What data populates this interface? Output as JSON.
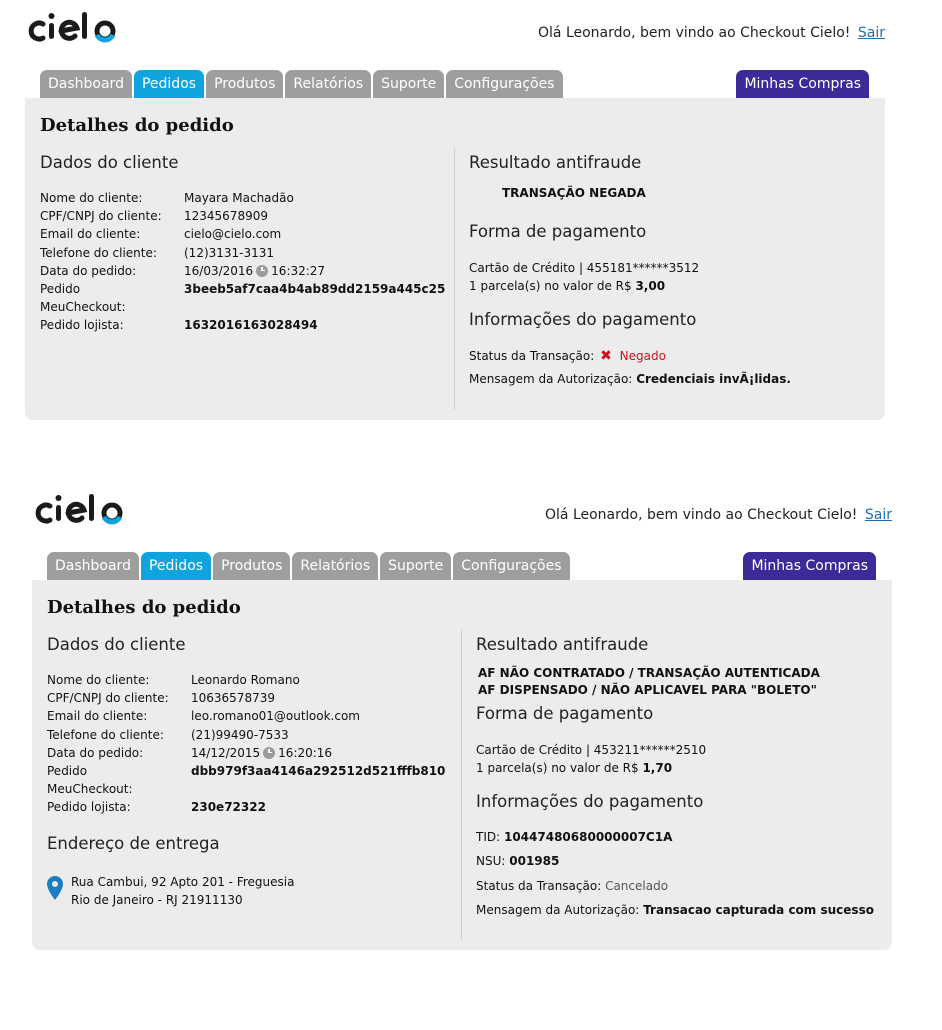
{
  "colors": {
    "active_tab": "#10a4df",
    "tab": "#9e9e9e",
    "minhas_compras": "#3b2a98",
    "panel": "#ececec",
    "negado": "#c9151f",
    "link": "#1a6fb7"
  },
  "icons": {
    "logo": "cielo-logo",
    "clock": "clock-icon",
    "deny": "x-icon",
    "location": "map-pin-icon"
  },
  "screens": [
    {
      "header": {
        "logo_text": "cielo",
        "greeting": "Olá Leonardo, bem vindo ao Checkout Cielo!",
        "logout": "Sair"
      },
      "tabs": [
        "Dashboard",
        "Pedidos",
        "Produtos",
        "Relatórios",
        "Suporte",
        "Configurações"
      ],
      "active_tab": "Pedidos",
      "minhas_compras": "Minhas Compras",
      "title": "Detalhes do pedido",
      "cliente": {
        "heading": "Dados do cliente",
        "nome_label": "Nome do cliente:",
        "nome": "Mayara Machadão",
        "cpf_label": "CPF/CNPJ do cliente:",
        "cpf": "12345678909",
        "email_label": "Email do cliente:",
        "email": "cielo@cielo.com",
        "telefone_label": "Telefone do cliente:",
        "telefone": "(12)3131-3131",
        "data_label": "Data do pedido:",
        "data": "16/03/2016",
        "hora": "16:32:27",
        "pedido_label": "Pedido",
        "pedido_label2": "MeuCheckout:",
        "pedido": "3beeb5af7caa4b4ab89dd2159a445c25",
        "lojista_label": "Pedido lojista:",
        "lojista": "1632016163028494"
      },
      "antifraude": {
        "heading": "Resultado antifraude",
        "line1": "TRANSAÇÃO NEGADA"
      },
      "pagamento": {
        "heading": "Forma de pagamento",
        "cartao": "Cartão de Crédito | 455181******3512",
        "parcela_prefix": "1 parcela(s) no valor de R$",
        "parcela_valor": "3,00"
      },
      "info": {
        "heading": "Informações do pagamento",
        "status_label": "Status da Transação:",
        "status": "Negado",
        "msg_label": "Mensagem da Autorização:",
        "msg": "Credenciais invÃ¡lidas."
      }
    },
    {
      "header": {
        "logo_text": "cielo",
        "greeting": "Olá Leonardo, bem vindo ao Checkout Cielo!",
        "logout": "Sair"
      },
      "tabs": [
        "Dashboard",
        "Pedidos",
        "Produtos",
        "Relatórios",
        "Suporte",
        "Configurações"
      ],
      "active_tab": "Pedidos",
      "minhas_compras": "Minhas Compras",
      "title": "Detalhes do pedido",
      "cliente": {
        "heading": "Dados do cliente",
        "nome_label": "Nome do cliente:",
        "nome": "Leonardo Romano",
        "cpf_label": "CPF/CNPJ do cliente:",
        "cpf": "10636578739",
        "email_label": "Email do cliente:",
        "email": "leo.romano01@outlook.com",
        "telefone_label": "Telefone do cliente:",
        "telefone": "(21)99490-7533",
        "data_label": "Data do pedido:",
        "data": "14/12/2015",
        "hora": "16:20:16",
        "pedido_label": "Pedido",
        "pedido_label2": "MeuCheckout:",
        "pedido": "dbb979f3aa4146a292512d521fffb810",
        "lojista_label": "Pedido lojista:",
        "lojista": "230e72322"
      },
      "entrega": {
        "heading": "Endereço de entrega",
        "line1": "Rua Cambui, 92 Apto 201 - Freguesia",
        "line2": "Rio de Janeiro - RJ 21911130"
      },
      "antifraude": {
        "heading": "Resultado antifraude",
        "line1": "AF NÃO CONTRATADO / TRANSAÇÃO AUTENTICADA",
        "line2": "AF DISPENSADO / NÃO APLICAVEL PARA \"BOLETO\""
      },
      "pagamento": {
        "heading": "Forma de pagamento",
        "cartao": "Cartão de Crédito | 453211******2510",
        "parcela_prefix": "1 parcela(s) no valor de R$",
        "parcela_valor": "1,70"
      },
      "info": {
        "heading": "Informações do pagamento",
        "tid_label": "TID:",
        "tid": "10447480680000007C1A",
        "nsu_label": "NSU:",
        "nsu": "001985",
        "status_label": "Status da Transação:",
        "status": "Cancelado",
        "msg_label": "Mensagem da Autorização:",
        "msg": "Transacao capturada com sucesso"
      }
    }
  ]
}
